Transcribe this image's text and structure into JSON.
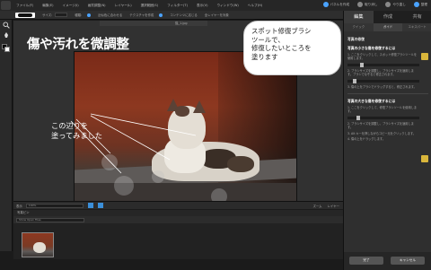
{
  "menubar": {
    "items": [
      "ファイル(F)",
      "編集(E)",
      "イメージ(I)",
      "画質調整(N)",
      "レイヤー(L)",
      "選択範囲(S)",
      "フィルター(T)",
      "表示(V)",
      "ウィンドウ(W)",
      "ヘルプ(H)"
    ],
    "actions": [
      "パネルを作成",
      "取り消し",
      "やり直し",
      "整理"
    ]
  },
  "options": {
    "labels": [
      "サイズ:",
      "種類:",
      "近似色に合わせる",
      "テクスチャを作成",
      "コンテンツに応じる",
      "全レイヤーを対象"
    ]
  },
  "document": {
    "tab_label": "猫_1.jpg",
    "title": "傷や汚れを微調整"
  },
  "annotation": {
    "line1": "この辺りを",
    "line2": "塗ってみました"
  },
  "callout": {
    "line1": "スポット修復ブラシ",
    "line2": "ツールで、",
    "line3": "修復したいところを",
    "line4": "塗ります"
  },
  "statusbar": {
    "zoom_label": "表示",
    "zoom_value": "100%",
    "fit_label": "ズーム",
    "mode_label": "レイヤー"
  },
  "bin": {
    "header": "写真ビン",
    "select_value": "Show Open Files"
  },
  "panel": {
    "tabs": [
      "編集",
      "作成",
      "共有"
    ],
    "subtabs": [
      "クイック",
      "ガイド",
      "エキスパート"
    ],
    "section_head": "写真の修復",
    "s1_title": "写真の小さな傷を修復するには",
    "s1_text1": "1. ここをクリックして、スポット修復ブラシツールを使用します。",
    "s1_text2": "2. ブラシサイズを調整し、ブラシサイズを適用します。ブラシでなぞると修正されます。",
    "s1_text3": "3. 傷の上をブラシでドラッグすると、修正されます。",
    "s2_title": "写真の大きな傷を修復するには",
    "s2_text1": "1. ここをクリックして、修復ブラシツールを使用します。",
    "s2_text2": "2. ブラシサイズを調整し、ブラシサイズを適用します。",
    "s2_text3": "3. Alt キーを押しながらコピー元をクリックします。",
    "s2_text4": "4. 傷の上をドラッグします。",
    "done_label": "完了",
    "cancel_label": "キャンセル"
  },
  "colors": {
    "accent": "#4aa3ff",
    "callout_bg": "#ffffff",
    "callout_text": "#1a1a1a",
    "panel_bg": "#2f2f2f"
  }
}
